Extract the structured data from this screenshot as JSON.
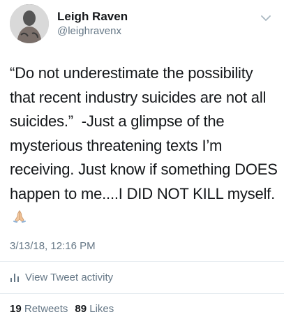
{
  "user": {
    "name": "Leigh Raven",
    "handle": "@leighravenx"
  },
  "tweet": {
    "text": "“Do not underestimate the possibility that recent industry suicides are not all suicides.”  -Just a glimpse of the mysterious threatening texts I’m receiving. Just know if something DOES happen to me....I DID NOT KILL myself.",
    "emoji": "folded-hands-icon",
    "timestamp": "3/13/18, 12:16 PM"
  },
  "activity": {
    "label": "View Tweet activity",
    "icon": "bar-chart-icon"
  },
  "stats": {
    "retweets_count": "19",
    "retweets_label": "Retweets",
    "likes_count": "89",
    "likes_label": "Likes"
  },
  "colors": {
    "text": "#14171a",
    "secondary": "#657786",
    "divider": "#e6ecf0"
  }
}
